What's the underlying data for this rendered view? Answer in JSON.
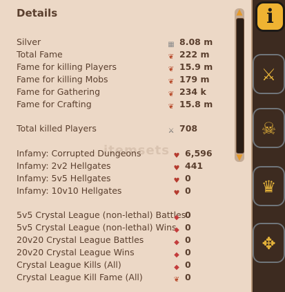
{
  "panel": {
    "title": "Details",
    "watermark": "itemsets"
  },
  "stats": [
    {
      "label": "Silver",
      "value": "8.08 m",
      "icon": "silver-coins-icon"
    },
    {
      "label": "Total Fame",
      "value": "222 m",
      "icon": "fame-icon"
    },
    {
      "label": "Fame for killing Players",
      "value": "15.9 m",
      "icon": "fame-icon"
    },
    {
      "label": "Fame for killing Mobs",
      "value": "179 m",
      "icon": "fame-icon"
    },
    {
      "label": "Fame for Gathering",
      "value": "234 k",
      "icon": "fame-icon"
    },
    {
      "label": "Fame for Crafting",
      "value": "15.8 m",
      "icon": "fame-icon"
    },
    {
      "label": "Total killed Players",
      "value": "708",
      "icon": "crossed-swords-icon"
    },
    {
      "label": "Infamy: Corrupted Dungeons",
      "value": "6,596",
      "icon": "infamy-icon"
    },
    {
      "label": "Infamy: 2v2 Hellgates",
      "value": "441",
      "icon": "infamy-icon"
    },
    {
      "label": "Infamy: 5v5 Hellgates",
      "value": "0",
      "icon": "infamy-icon"
    },
    {
      "label": "Infamy: 10v10 Hellgates",
      "value": "0",
      "icon": "infamy-icon"
    },
    {
      "label": "5v5 Crystal League (non-lethal) Battles",
      "value": "0",
      "icon": "crystal-league-icon"
    },
    {
      "label": "5v5 Crystal League (non-lethal) Wins",
      "value": "0",
      "icon": "crystal-league-icon"
    },
    {
      "label": "20v20 Crystal League Battles",
      "value": "0",
      "icon": "crystal-league-icon"
    },
    {
      "label": "20v20 Crystal League Wins",
      "value": "0",
      "icon": "crystal-league-icon"
    },
    {
      "label": "Crystal League Kills (All)",
      "value": "0",
      "icon": "crystal-league-icon"
    },
    {
      "label": "Crystal League Kill Fame (All)",
      "value": "0",
      "icon": "fame-icon"
    }
  ],
  "sidebar": {
    "info_label": "i",
    "tabs": [
      "info-tab",
      "combat-tab",
      "pvp-skull-tab",
      "trophy-tab",
      "guild-war-tab"
    ]
  },
  "colors": {
    "panel_bg": "#ecd8c6",
    "text": "#5a3f2e",
    "accent": "#efb332",
    "frame": "#3d2b20"
  }
}
